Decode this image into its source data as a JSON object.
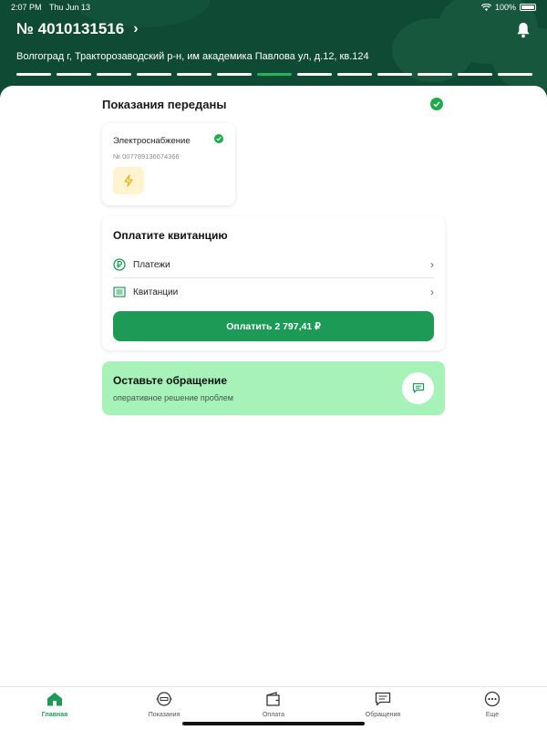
{
  "status_bar": {
    "time": "2:07 PM",
    "date": "Thu Jun 13",
    "battery": "100%"
  },
  "header": {
    "account_number": "№ 4010131516",
    "address": "Волгоград г, Тракторозаводский р-н, им академика Павлова ул, д.12, кв.124",
    "progress": {
      "segments": 13,
      "active_index": 6
    }
  },
  "readings": {
    "title": "Показания переданы",
    "meter": {
      "name": "Электроснабжение",
      "number": "№ 007789136074366",
      "icon": "lightning-icon"
    }
  },
  "payment": {
    "title": "Оплатите квитанцию",
    "rows": [
      {
        "label": "Платежи",
        "icon": "ruble-circle-icon"
      },
      {
        "label": "Квитанции",
        "icon": "receipt-list-icon"
      }
    ],
    "pay_button": "Оплатить 2 797,41 ₽"
  },
  "appeal": {
    "title": "Оставьте обращение",
    "subtitle": "оперативное решение проблем",
    "icon": "chat-icon"
  },
  "tabbar": {
    "active": "Главная",
    "items": [
      {
        "label": "Главная",
        "icon": "home-icon"
      },
      {
        "label": "Показания",
        "icon": "meter-icon"
      },
      {
        "label": "Оплата",
        "icon": "wallet-icon"
      },
      {
        "label": "Обращения",
        "icon": "message-icon"
      },
      {
        "label": "Еще",
        "icon": "more-icon"
      }
    ]
  },
  "colors": {
    "header": "#0f4a34",
    "accent": "#1e9a57",
    "appeal_bg": "#a6f2b9"
  }
}
